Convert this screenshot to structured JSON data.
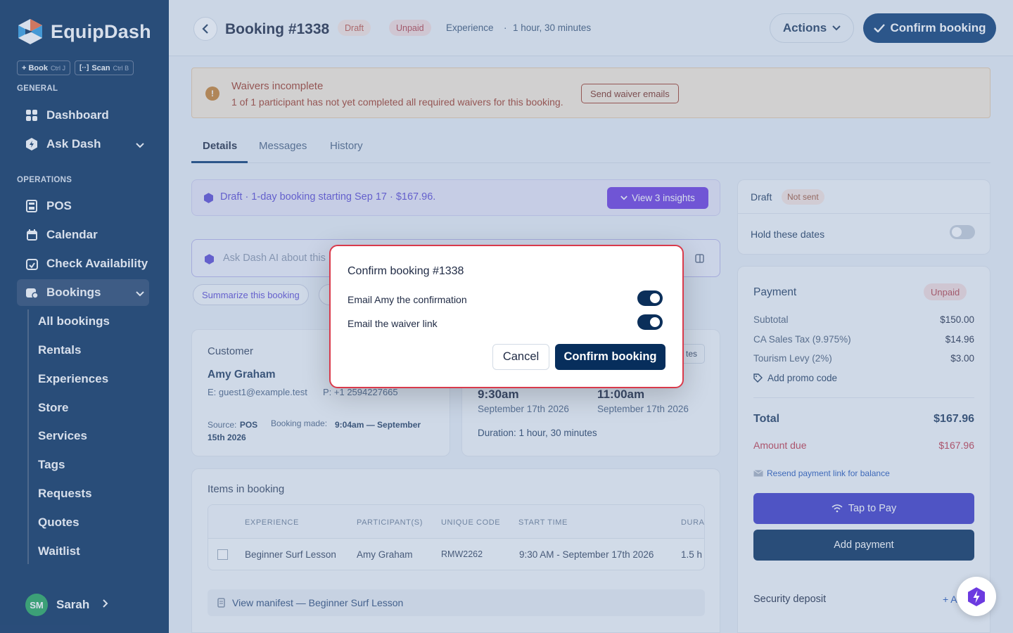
{
  "sidebar": {
    "brand": "EquipDash",
    "quick": [
      {
        "label": "+ Book",
        "key": "Ctrl J"
      },
      {
        "label": "Scan",
        "key": "Ctrl B"
      }
    ],
    "general_label": "GENERAL",
    "operations_label": "OPERATIONS",
    "general_items": [
      {
        "label": "Dashboard",
        "icon": "grid-icon"
      },
      {
        "label": "Ask Dash",
        "icon": "hexagon-icon"
      }
    ],
    "ops_items": [
      {
        "label": "POS",
        "icon": "register-icon"
      },
      {
        "label": "Calendar",
        "icon": "calendar-icon"
      },
      {
        "label": "Check Availability",
        "icon": "calendar-check-icon"
      },
      {
        "label": "Bookings",
        "icon": "bookings-icon"
      }
    ],
    "sub_items": [
      "All bookings",
      "Rentals",
      "Experiences",
      "Store",
      "Services",
      "Tags",
      "Requests",
      "Quotes",
      "Waitlist"
    ],
    "user": {
      "initials": "SM",
      "name": "Sarah"
    }
  },
  "header": {
    "title": "Booking #1338",
    "badge_draft": "Draft",
    "badge_unpaid": "Unpaid",
    "type": "Experience",
    "sep": "·",
    "duration": "1 hour, 30 minutes",
    "actions_label": "Actions",
    "confirm_label": "Confirm booking"
  },
  "alert": {
    "title": "Waivers incomplete",
    "text": "1 of 1 participant has not yet completed all required waivers for this booking.",
    "button": "Send waiver emails"
  },
  "tabs": [
    "Details",
    "Messages",
    "History"
  ],
  "insight": {
    "text": "Draft · 1-day booking starting Sep 17 · $167.96.",
    "button": "View  3 insights"
  },
  "ask": {
    "placeholder": "Ask Dash AI about this",
    "suggestion": "Summarize this booking"
  },
  "customer": {
    "heading": "Customer",
    "name": "Amy Graham",
    "email": "E: guest1@example.test",
    "phone": "P: +1 2594227665",
    "source_label": "Source:",
    "source": "POS",
    "made_label": "Booking made:",
    "made": "9:04am — September 15th 2026"
  },
  "timing": {
    "tag": "tes",
    "start_time": "9:30am",
    "start_date": "September 17th 2026",
    "end_time": "11:00am",
    "end_date": "September 17th 2026",
    "duration": "Duration: 1 hour, 30 minutes"
  },
  "items": {
    "heading": "Items in booking",
    "columns": [
      "EXPERIENCE",
      "PARTICIPANT(S)",
      "UNIQUE CODE",
      "START TIME",
      "DURA"
    ],
    "row": [
      "Beginner Surf Lesson",
      "Amy Graham",
      "RMW2262",
      "9:30 AM - September 17th 2026",
      "1.5 h"
    ],
    "manifest": "View manifest — Beginner Surf Lesson"
  },
  "status_card": {
    "draft": "Draft",
    "not_sent": "Not sent",
    "hold_label": "Hold these dates"
  },
  "payment": {
    "heading": "Payment",
    "badge": "Unpaid",
    "lines": [
      {
        "label": "Subtotal",
        "value": "$150.00"
      },
      {
        "label": "CA Sales Tax (9.975%)",
        "value": "$14.96"
      },
      {
        "label": "Tourism Levy (2%)",
        "value": "$3.00"
      }
    ],
    "promo": "Add promo code",
    "total_label": "Total",
    "total": "$167.96",
    "due_label": "Amount due",
    "due": "$167.96",
    "resend": "Resend payment link for balance",
    "tap": "Tap to Pay",
    "add_payment": "Add payment",
    "deposit_label": "Security deposit",
    "deposit_action": "+ A"
  },
  "modal": {
    "title": "Confirm booking #1338",
    "option1": "Email Amy the confirmation",
    "option2": "Email the waiver link",
    "option1_on": true,
    "option2_on": true,
    "cancel": "Cancel",
    "confirm": "Confirm booking"
  },
  "colors": {
    "sidebar": "#072e5c",
    "primary": "#0b3b74",
    "accent": "#6c3ae0",
    "danger": "#d93a4b"
  }
}
